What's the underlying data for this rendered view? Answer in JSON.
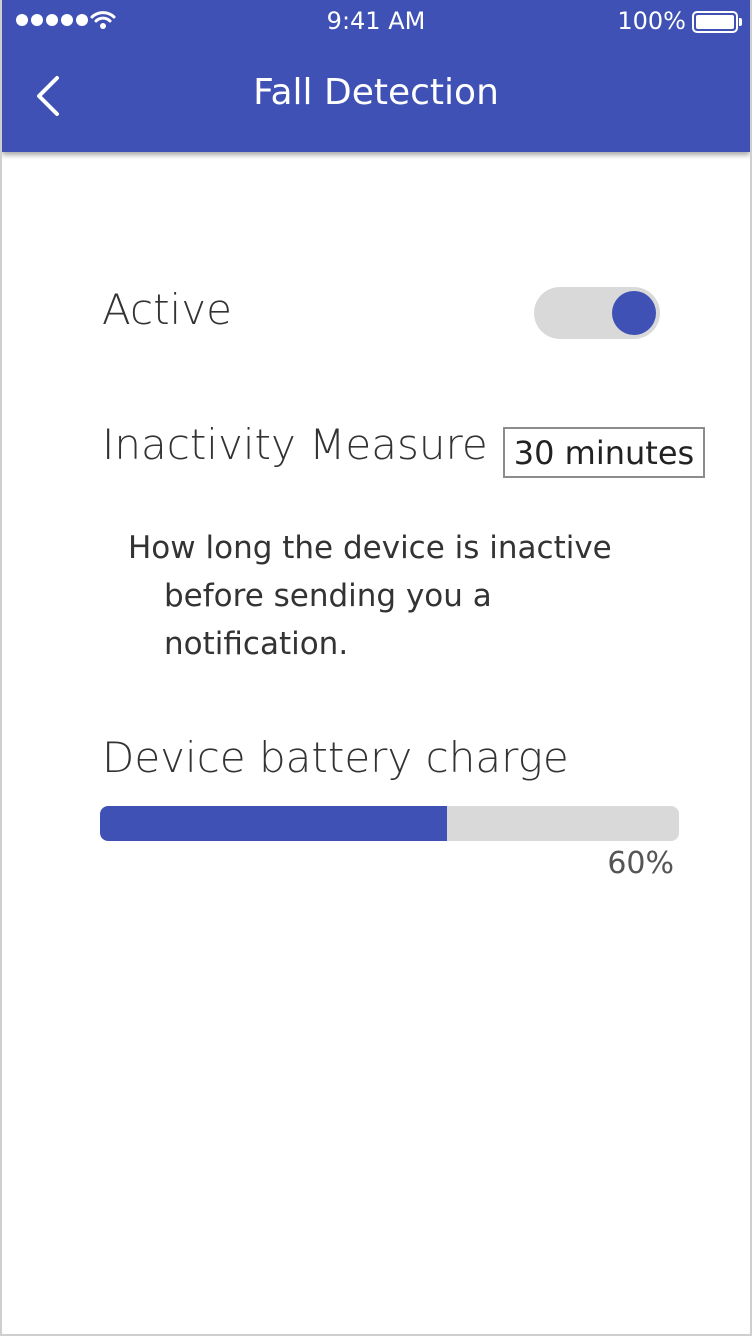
{
  "status_bar": {
    "time": "9:41 AM",
    "battery_percent": "100%",
    "signal_icon": "signal-dots-icon",
    "wifi_icon": "wifi-icon",
    "battery_icon": "battery-full-icon"
  },
  "header": {
    "title": "Fall Detection",
    "back_icon": "chevron-left-icon",
    "color": "#3f51b5"
  },
  "settings": {
    "active": {
      "label": "Active",
      "enabled": true
    },
    "inactivity": {
      "label": "Inactivity Measure",
      "value": "30 minutes",
      "help_line1": "How long the device is inactive",
      "help_line2": "before sending you a",
      "help_line3": "notification."
    },
    "battery": {
      "label": "Device battery charge",
      "level": 0.6,
      "percent_text": "60%"
    }
  },
  "colors": {
    "accent": "#3f51b5",
    "track": "#d9d9d9",
    "text": "#333333"
  }
}
